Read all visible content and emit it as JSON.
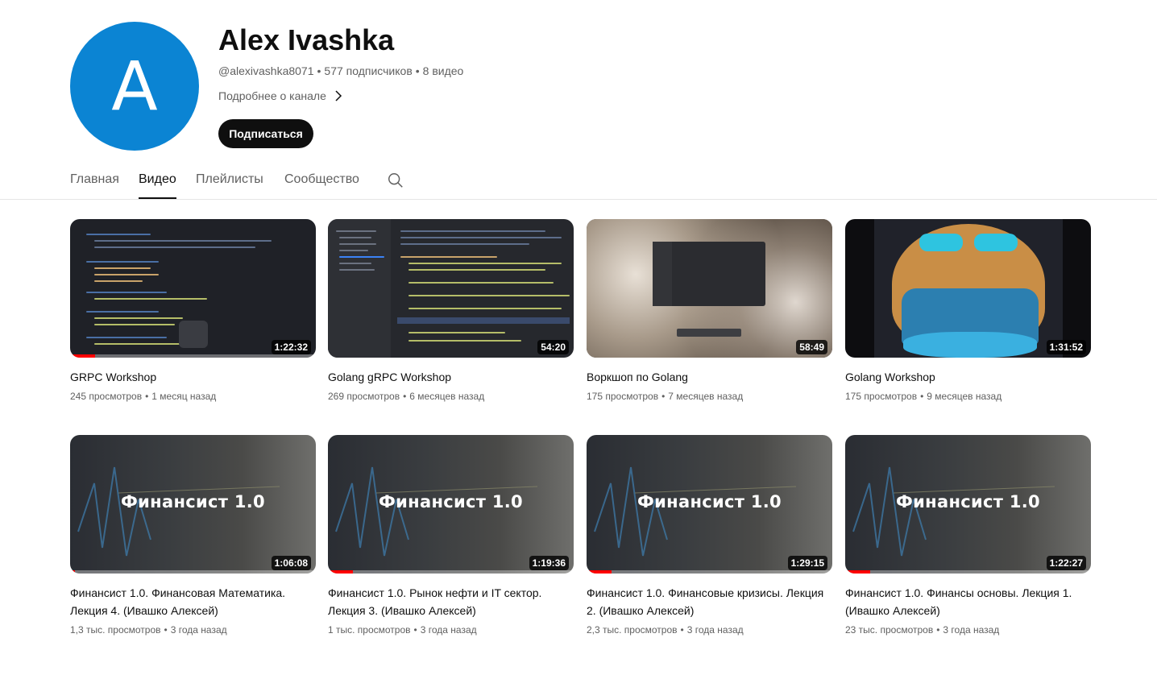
{
  "channel": {
    "avatar_letter": "A",
    "name": "Alex Ivashka",
    "handle": "@alexivashka8071",
    "subscribers": "577 подписчиков",
    "video_count": "8 видео",
    "more_label": "Подробнее о канале",
    "subscribe_label": "Подписаться"
  },
  "tabs": [
    {
      "label": "Главная"
    },
    {
      "label": "Видео"
    },
    {
      "label": "Плейлисты"
    },
    {
      "label": "Сообщество"
    }
  ],
  "videos": [
    {
      "title": "GRPC Workshop",
      "views": "245 просмотров",
      "age": "1 месяц назад",
      "duration": "1:22:32",
      "watched": 0.1,
      "thumb_text": ""
    },
    {
      "title": "Golang gRPC Workshop",
      "views": "269 просмотров",
      "age": "6 месяцев назад",
      "duration": "54:20",
      "watched": 0,
      "thumb_text": ""
    },
    {
      "title": "Воркшоп по Golang",
      "views": "175 просмотров",
      "age": "7 месяцев назад",
      "duration": "58:49",
      "watched": 0,
      "thumb_text": ""
    },
    {
      "title": "Golang Workshop",
      "views": "175 просмотров",
      "age": "9 месяцев назад",
      "duration": "1:31:52",
      "watched": 0,
      "thumb_text": ""
    },
    {
      "title": "Финансист 1.0. Финансовая Математика. Лекция 4. (Ивашко Алексей)",
      "views": "1,3 тыс. просмотров",
      "age": "3 года назад",
      "duration": "1:06:08",
      "watched": 0.02,
      "thumb_text": "Финансист 1.0"
    },
    {
      "title": "Финансист 1.0. Рынок нефти и IT сектор. Лекция 3. (Ивашко Алексей)",
      "views": "1 тыс. просмотров",
      "age": "3 года назад",
      "duration": "1:19:36",
      "watched": 0.1,
      "thumb_text": "Финансист 1.0"
    },
    {
      "title": "Финансист 1.0. Финансовые кризисы. Лекция 2. (Ивашко Алексей)",
      "views": "2,3 тыс. просмотров",
      "age": "3 года назад",
      "duration": "1:29:15",
      "watched": 0.1,
      "thumb_text": "Финансист 1.0"
    },
    {
      "title": "Финансист 1.0. Финансы основы. Лекция 1. (Ивашко Алексей)",
      "views": "23 тыс. просмотров",
      "age": "3 года назад",
      "duration": "1:22:27",
      "watched": 0.1,
      "thumb_text": "Финансист 1.0"
    }
  ],
  "colors": {
    "avatar": "#0b84d3",
    "progress": "#ff0000",
    "subscribe_bg": "#0f0f0f"
  }
}
